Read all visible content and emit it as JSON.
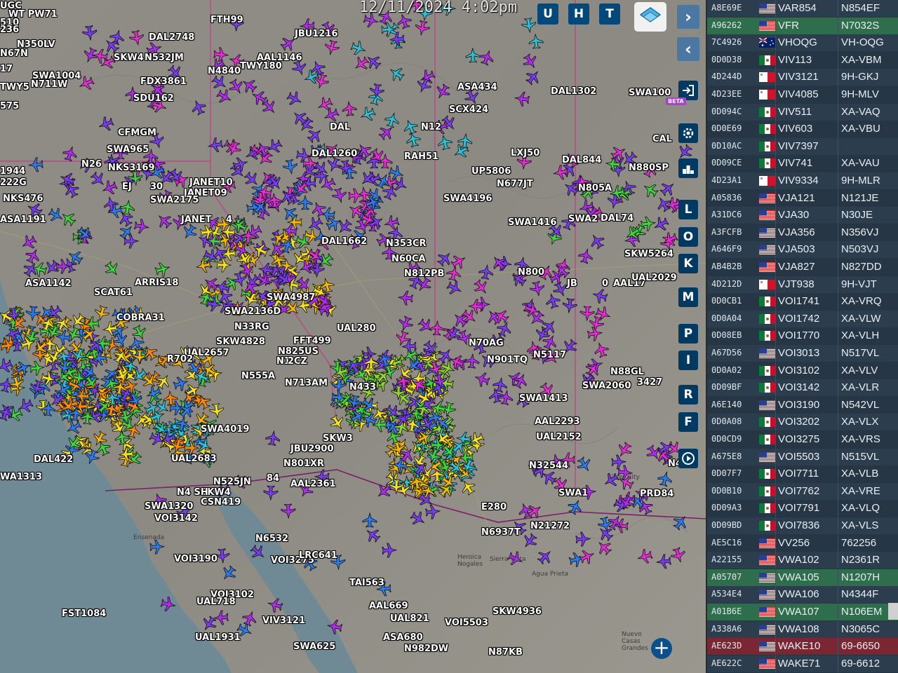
{
  "clock": "12/11/2024  4:02pm",
  "map_buttons": {
    "u": "U",
    "h": "H",
    "t": "T",
    "forward": "›",
    "back": "‹",
    "panel_toggle": "◂▸"
  },
  "right_buttons": [
    "L",
    "O",
    "K",
    "M",
    "P",
    "I",
    "R",
    "F"
  ],
  "beta_label": "BETA",
  "zoom_plus": "+",
  "cities": {
    "ensenada": "Ensenada",
    "heroica_nogales": "Heroica\nNogales",
    "sierra_vista": "Sierra Vista",
    "agua_prieta": "Agua Prieta",
    "silver_city": "Silver City",
    "nuevo_casas_grandes": "Nuevo\nCasas Grandes"
  },
  "aircraft_labels": [
    "UGC",
    "WT PW71",
    "510",
    "236",
    "N350LV",
    "N67N",
    "17",
    "FTH99",
    "DAL2748",
    "JBU1216",
    "SKW4",
    "N532JM",
    "AAL1146",
    "TWY180",
    "N4840",
    "SWA1004",
    "N711W",
    "FDX3861",
    "SDU162",
    "TWY5",
    "575",
    "DAL1302",
    "ASA434",
    "SWA100",
    "SCX424",
    "N12",
    "DAL",
    "CFMGM",
    "SWA965",
    "N26",
    "NKS3169",
    "DAL1260",
    "RAH51",
    "LXJ50",
    "DAL844",
    "N880SP",
    "UP5806",
    "N677JT",
    "JANET10",
    "JANET09",
    "SWA2175",
    "EJ",
    "30",
    "1944",
    "222G",
    "NKS476",
    "ASA1191",
    "SWA4196",
    "N805A",
    "CAL",
    "JANET",
    "4",
    "SWA1416",
    "SWA2",
    "DAL74",
    "DAL1662",
    "N353CR",
    "N60CA",
    "N812PB",
    "N800",
    "SKW5264",
    "ARRIS18",
    "SCAT61",
    "ASA1142",
    "JB",
    "0",
    "AAL17",
    "UAL2029",
    "SWA4987",
    "COBRA31",
    "SWA2136D",
    "N33RG",
    "UAL280",
    "N5117",
    "N901TQ",
    "N70AG",
    "SWA2060",
    "N88GL",
    "3427",
    "UAL2657",
    "SKW4828",
    "FFT499",
    "N825US",
    "N1",
    "2CZ",
    "R702",
    "N555A",
    "N713AM",
    "N433",
    "SWA1413",
    "AAL2293",
    "UAL2152",
    "SWA4019",
    "SKW3",
    "JBU2900",
    "N801XR",
    "AAL2361",
    "N525JN",
    "84",
    "SKW4",
    "DAL422",
    "UAL2683",
    "N32544",
    "VOI3142",
    "CSN419",
    "SWA1320",
    "N4 SH",
    "E280",
    "N6937T",
    "N21272",
    "PRD84",
    "SWA1",
    "N6532",
    "VOI3275",
    "LRC641",
    "VOI3190",
    "TAI563",
    "AAL669",
    "UAL821",
    "SKW4936",
    "VOI5503",
    "VOI3102",
    "UAL718",
    "VIV3121",
    "FST1084",
    "UAL1931",
    "SWA625",
    "ASA680",
    "N982DW",
    "N87KB",
    "WA1313",
    "N4 2"
  ],
  "flights": [
    {
      "hex": "A8E69E",
      "flag": "us",
      "callsign": "VAR854",
      "reg": "N854EF",
      "style": "alt"
    },
    {
      "hex": "A96262",
      "flag": "us",
      "callsign": "VFR",
      "reg": "N7032S",
      "style": "sel"
    },
    {
      "hex": "7C4926",
      "flag": "au",
      "callsign": "VHOQG",
      "reg": "VH-OQG",
      "style": "alt"
    },
    {
      "hex": "0D0D38",
      "flag": "mx",
      "callsign": "VIV113",
      "reg": "XA-VBM",
      "style": ""
    },
    {
      "hex": "4D244D",
      "flag": "mt",
      "callsign": "VIV3121",
      "reg": "9H-GKJ",
      "style": "alt"
    },
    {
      "hex": "4D23EE",
      "flag": "mt",
      "callsign": "VIV4085",
      "reg": "9H-MLV",
      "style": ""
    },
    {
      "hex": "0D094C",
      "flag": "mx",
      "callsign": "VIV511",
      "reg": "XA-VAQ",
      "style": "alt"
    },
    {
      "hex": "0D0E69",
      "flag": "mx",
      "callsign": "VIV603",
      "reg": "XA-VBU",
      "style": ""
    },
    {
      "hex": "0D10AC",
      "flag": "mx",
      "callsign": "VIV7397",
      "reg": "",
      "style": "alt"
    },
    {
      "hex": "0D09CE",
      "flag": "mx",
      "callsign": "VIV741",
      "reg": "XA-VAU",
      "style": ""
    },
    {
      "hex": "4D23A1",
      "flag": "mt",
      "callsign": "VIV9334",
      "reg": "9H-MLR",
      "style": "alt"
    },
    {
      "hex": "A05836",
      "flag": "us",
      "callsign": "VJA121",
      "reg": "N121JE",
      "style": ""
    },
    {
      "hex": "A31DC6",
      "flag": "us",
      "callsign": "VJA30",
      "reg": "N30JE",
      "style": "alt"
    },
    {
      "hex": "A3FCFB",
      "flag": "us",
      "callsign": "VJA356",
      "reg": "N356VJ",
      "style": ""
    },
    {
      "hex": "A646F9",
      "flag": "us",
      "callsign": "VJA503",
      "reg": "N503VJ",
      "style": "alt"
    },
    {
      "hex": "AB4B2B",
      "flag": "us",
      "callsign": "VJA827",
      "reg": "N827DD",
      "style": ""
    },
    {
      "hex": "4D212D",
      "flag": "mt",
      "callsign": "VJT938",
      "reg": "9H-VJT",
      "style": "alt"
    },
    {
      "hex": "0D0CB1",
      "flag": "mx",
      "callsign": "VOI1741",
      "reg": "XA-VRQ",
      "style": ""
    },
    {
      "hex": "0D0A04",
      "flag": "mx",
      "callsign": "VOI1742",
      "reg": "XA-VLW",
      "style": "alt"
    },
    {
      "hex": "0D08EB",
      "flag": "mx",
      "callsign": "VOI1770",
      "reg": "XA-VLH",
      "style": ""
    },
    {
      "hex": "A67D56",
      "flag": "us",
      "callsign": "VOI3013",
      "reg": "N517VL",
      "style": "alt"
    },
    {
      "hex": "0D0A02",
      "flag": "mx",
      "callsign": "VOI3102",
      "reg": "XA-VLV",
      "style": ""
    },
    {
      "hex": "0D09BF",
      "flag": "mx",
      "callsign": "VOI3142",
      "reg": "XA-VLR",
      "style": "alt"
    },
    {
      "hex": "A6E140",
      "flag": "us",
      "callsign": "VOI3190",
      "reg": "N542VL",
      "style": ""
    },
    {
      "hex": "0D0A08",
      "flag": "mx",
      "callsign": "VOI3202",
      "reg": "XA-VLX",
      "style": "alt"
    },
    {
      "hex": "0D0CD9",
      "flag": "mx",
      "callsign": "VOI3275",
      "reg": "XA-VRS",
      "style": ""
    },
    {
      "hex": "A675E8",
      "flag": "us",
      "callsign": "VOI5503",
      "reg": "N515VL",
      "style": "alt"
    },
    {
      "hex": "0D07F7",
      "flag": "mx",
      "callsign": "VOI7711",
      "reg": "XA-VLB",
      "style": ""
    },
    {
      "hex": "0D0B10",
      "flag": "mx",
      "callsign": "VOI7762",
      "reg": "XA-VRE",
      "style": "alt"
    },
    {
      "hex": "0D09A3",
      "flag": "mx",
      "callsign": "VOI7791",
      "reg": "XA-VLQ",
      "style": ""
    },
    {
      "hex": "0D09BD",
      "flag": "mx",
      "callsign": "VOI7836",
      "reg": "XA-VLS",
      "style": "alt"
    },
    {
      "hex": "AE5C16",
      "flag": "us",
      "callsign": "VV256",
      "reg": "762256",
      "style": ""
    },
    {
      "hex": "A22155",
      "flag": "us",
      "callsign": "VWA102",
      "reg": "N2361R",
      "style": "alt"
    },
    {
      "hex": "A05707",
      "flag": "us",
      "callsign": "VWA105",
      "reg": "N1207H",
      "style": "sel"
    },
    {
      "hex": "A534E4",
      "flag": "us",
      "callsign": "VWA106",
      "reg": "N4344F",
      "style": "alt"
    },
    {
      "hex": "A01B6E",
      "flag": "us",
      "callsign": "VWA107",
      "reg": "N106EM",
      "style": "sel"
    },
    {
      "hex": "A338A6",
      "flag": "us",
      "callsign": "VWA108",
      "reg": "N3065C",
      "style": "alt"
    },
    {
      "hex": "AE623D",
      "flag": "us",
      "callsign": "WAKE10",
      "reg": "69-6650",
      "style": "red"
    },
    {
      "hex": "AE622C",
      "flag": "us",
      "callsign": "WAKE71",
      "reg": "69-6612",
      "style": "alt"
    }
  ],
  "aircraft_colors": [
    "#f7e31b",
    "#f5b800",
    "#ff8a00",
    "#3ad63a",
    "#8fd62a",
    "#2ac2d6",
    "#2a7bf0",
    "#7a3af0",
    "#b22af0",
    "#e62ad6",
    "#d0d0d0",
    "#1f9bff"
  ]
}
